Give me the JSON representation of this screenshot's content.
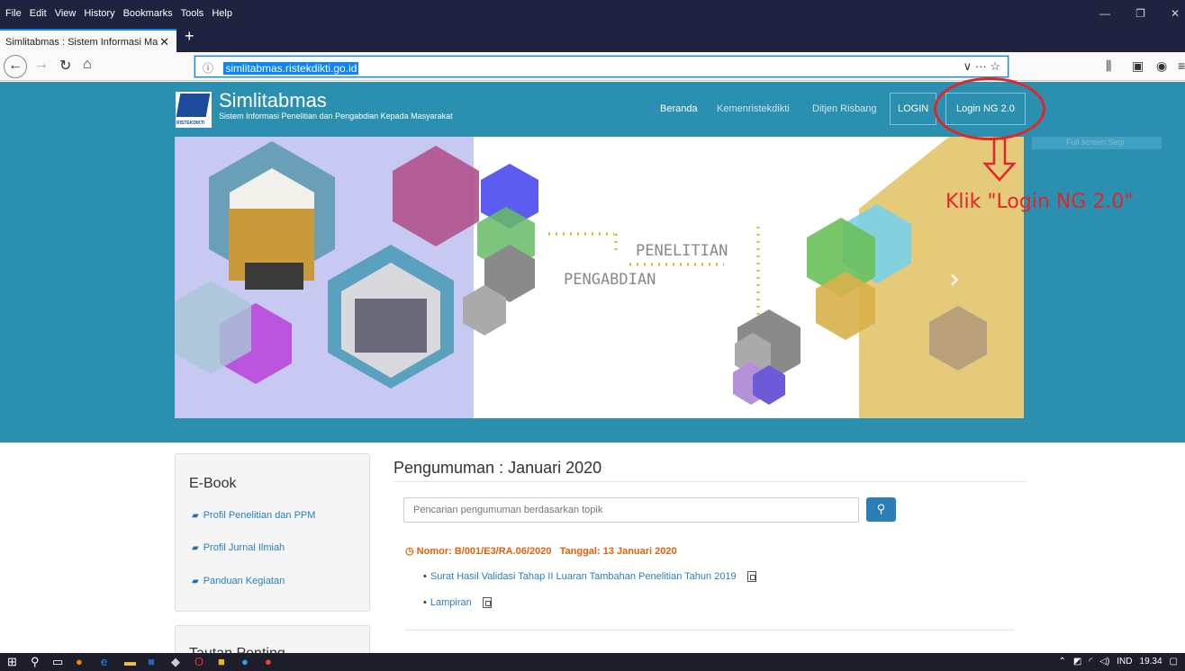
{
  "browser": {
    "menu": [
      "File",
      "Edit",
      "View",
      "History",
      "Bookmarks",
      "Tools",
      "Help"
    ],
    "tab_title": "Simlitabmas : Sistem Informasi Ma",
    "url": "simlitabmas.ristekdikti.go.id",
    "new_tab": "+",
    "url_actions": "∨  ···  ☆"
  },
  "site": {
    "logo_text": "RISTEKDIKTI",
    "brand_title": "Simlitabmas",
    "brand_subtitle": "Sistem Informasi Penelitian dan Pengabdian Kepada Masyarakat",
    "nav": [
      "Beranda",
      "Kemenristekdikti",
      "Ditjen Risbang",
      "LOGIN",
      "Login NG 2.0"
    ],
    "search_ghost": "Full screen Segi"
  },
  "hero": {
    "text_penelitian": "PENELITIAN",
    "text_pengabdian": "PENGABDIAN",
    "next_arrow": "›",
    "active_slide_fraction": 0.33
  },
  "annotation": {
    "text": "Klik \"Login NG 2.0\""
  },
  "sidebar": {
    "ebook_title": "E-Book",
    "ebook_links": [
      "Profil Penelitian dan PPM",
      "Profil Jurnal Ilmiah",
      "Panduan Kegiatan"
    ],
    "tautan_title": "Tautan Penting"
  },
  "announcements": {
    "title": "Pengumuman : Januari 2020",
    "search_placeholder": "Pencarian pengumuman berdasarkan topik",
    "header": "Nomor: B/001/E3/RA.06/2020   Tanggal: 13 Januari 2020",
    "items": [
      "Surat Hasil Validasi Tahap II Luaran Tambahan Penelitian Tahun 2019",
      "Lampiran"
    ]
  },
  "taskbar": {
    "lang": "IND",
    "time": "19.34"
  },
  "colors": {
    "header_blue": "#2b8fb0",
    "accent_red": "#e0262a",
    "link_blue": "#2a7fb8",
    "announcement_orange": "#e0620d"
  }
}
